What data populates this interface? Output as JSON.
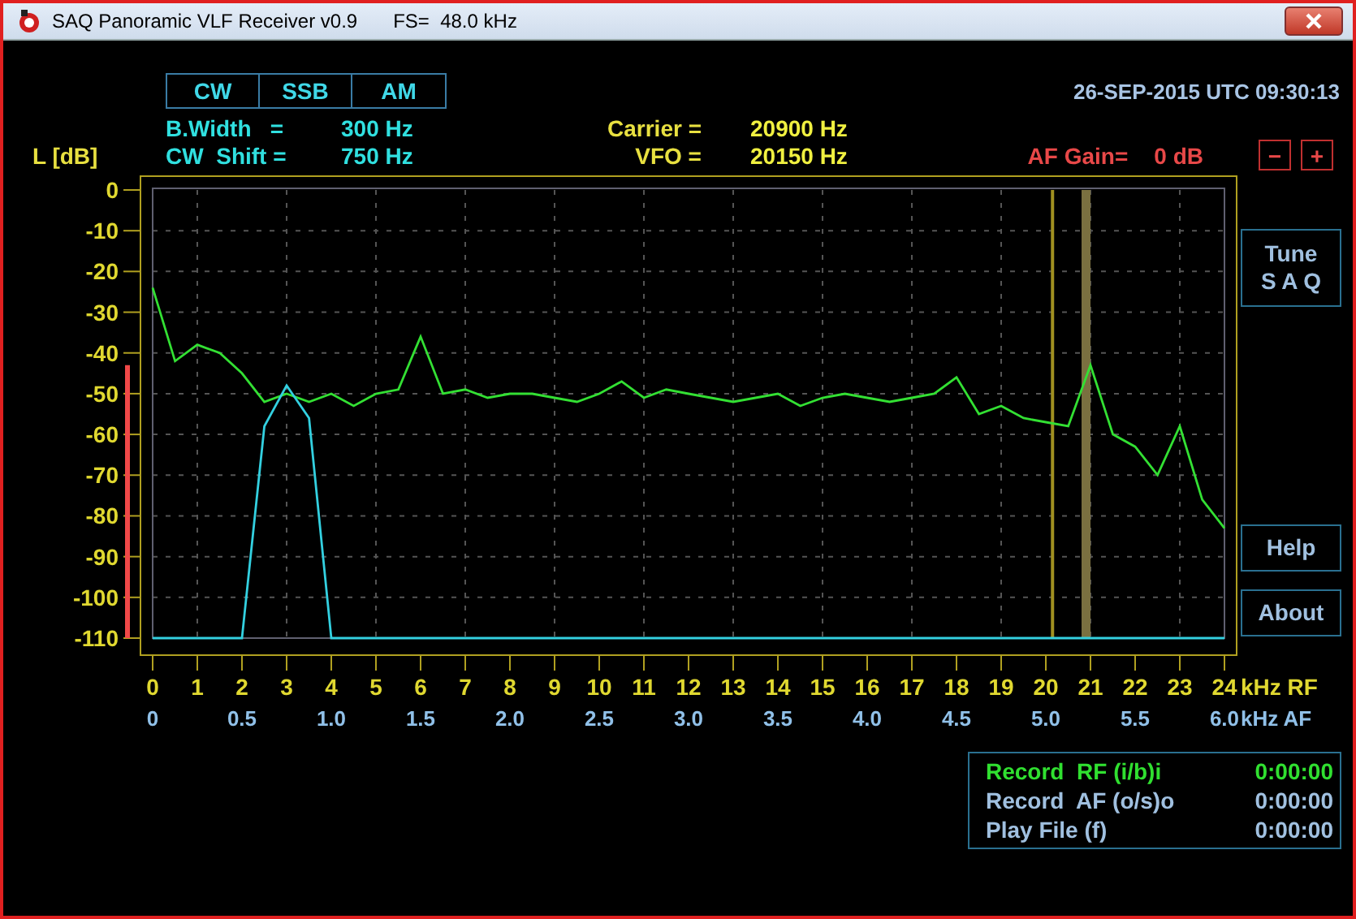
{
  "window": {
    "title": "SAQ Panoramic VLF Receiver v0.9",
    "sample_rate": "FS=  48.0 kHz"
  },
  "modes": [
    {
      "label": "CW"
    },
    {
      "label": "SSB"
    },
    {
      "label": "AM"
    }
  ],
  "datetime": "26-SEP-2015 UTC 09:30:13",
  "settings": [
    {
      "label": "B.Width   =",
      "value": "300 Hz"
    },
    {
      "label": "CW  Shift =",
      "value": "750 Hz"
    }
  ],
  "tuning": [
    {
      "label": "Carrier =",
      "value": "20900 Hz"
    },
    {
      "label": "VFO =",
      "value": "20150 Hz"
    }
  ],
  "af_gain": {
    "label": "AF Gain=",
    "value": "0 dB",
    "buttons": [
      "−",
      "+"
    ]
  },
  "spectrum": {
    "af_ticks": [
      "0",
      "0.5",
      "1.0",
      "1.5",
      "2.0",
      "2.5",
      "3.0",
      "3.5",
      "4.0",
      "4.5",
      "5.0",
      "5.5",
      "6.0"
    ],
    "af_unit": "kHz AF",
    "chart_data": {
      "type": "line",
      "ylabel": "L [dB]",
      "xlabel": "kHz RF",
      "xlim": [
        0,
        24
      ],
      "ylim": [
        -110,
        0
      ],
      "xticks": [
        0,
        1,
        2,
        3,
        4,
        5,
        6,
        7,
        8,
        9,
        10,
        11,
        12,
        13,
        14,
        15,
        16,
        17,
        18,
        19,
        20,
        21,
        22,
        23,
        24
      ],
      "yticks": [
        0,
        -10,
        -20,
        -30,
        -40,
        -50,
        -60,
        -70,
        -80,
        -90,
        -100,
        -110
      ],
      "x": [
        0,
        0.5,
        1,
        1.5,
        2,
        2.5,
        3,
        3.5,
        4,
        4.5,
        5,
        5.5,
        6,
        6.5,
        7,
        7.5,
        8,
        8.5,
        9,
        9.5,
        10,
        10.5,
        11,
        11.5,
        12,
        12.5,
        13,
        13.5,
        14,
        14.5,
        15,
        15.5,
        16,
        16.5,
        17,
        17.5,
        18,
        18.5,
        19,
        19.5,
        20,
        20.5,
        21,
        21.5,
        22,
        22.5,
        23,
        23.5,
        24
      ],
      "series": [
        {
          "color": "#33e033",
          "values": [
            -24,
            -42,
            -38,
            -40,
            -45,
            -52,
            -50,
            -52,
            -50,
            -53,
            -50,
            -49,
            -36,
            -50,
            -49,
            -51,
            -50,
            -50,
            -51,
            -52,
            -50,
            -47,
            -51,
            -49,
            -50,
            -51,
            -52,
            -51,
            -50,
            -53,
            -51,
            -50,
            -51,
            -52,
            -51,
            -50,
            -46,
            -55,
            -53,
            -56,
            -57,
            -58,
            -43,
            -60,
            -63,
            -70,
            -58,
            -76,
            -83
          ]
        },
        {
          "color": "#33d0e0",
          "values": [
            -110,
            -110,
            -110,
            -110,
            -110,
            -58,
            -48,
            -56,
            -110,
            -110,
            -110,
            -110,
            -110,
            -110,
            -110,
            -110,
            -110,
            -110,
            -110,
            -110,
            -110,
            -110,
            -110,
            -110,
            -110,
            -110,
            -110,
            -110,
            -110,
            -110,
            -110,
            -110,
            -110,
            -110,
            -110,
            -110,
            -110,
            -110,
            -110,
            -110,
            -110,
            -110,
            -110,
            -110,
            -110,
            -110,
            -110,
            -110,
            -110
          ]
        }
      ],
      "grid": true,
      "ref_lines": [
        {
          "axis": "x",
          "value": 20.15,
          "color": "#a09020"
        }
      ],
      "bands": [
        {
          "axis": "x",
          "from": 20.8,
          "to": 21.0,
          "color": "#7a7040"
        }
      ]
    }
  },
  "side_buttons": [
    {
      "lines": [
        "Tune",
        "S A Q"
      ]
    },
    {
      "lines": [
        "Help"
      ]
    },
    {
      "lines": [
        "About"
      ]
    }
  ],
  "recorders": [
    {
      "label": "Record  RF (i/b)i",
      "time": "0:00:00",
      "active": true
    },
    {
      "label": "Record  AF (o/s)o",
      "time": "0:00:00",
      "active": false
    },
    {
      "label": "Play File (f)",
      "time": "0:00:00",
      "active": false
    }
  ]
}
